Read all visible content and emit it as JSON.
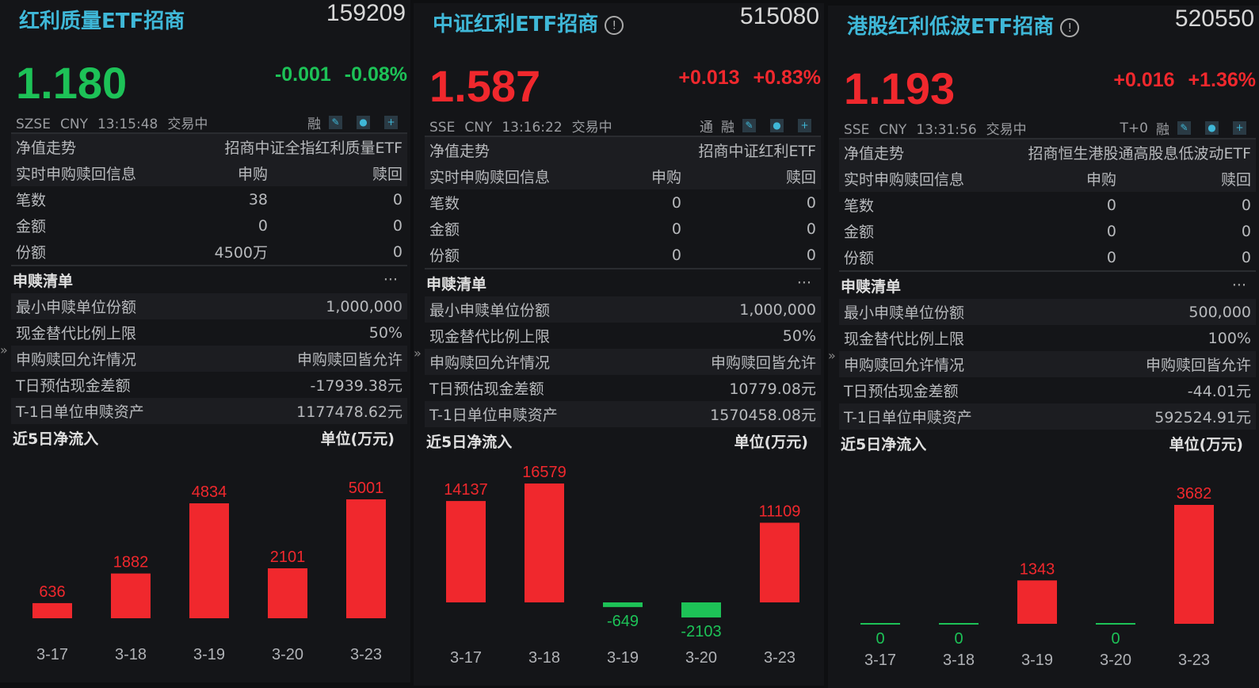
{
  "colors": {
    "up": "#f0282d",
    "down": "#1dc257",
    "title": "#3fb8d8"
  },
  "panels": [
    {
      "title": "红利质量ETF招商",
      "has_info": false,
      "code": "159209",
      "price": "1.180",
      "change": "-0.001",
      "change_pct": "-0.08%",
      "direction": "down",
      "exchange": "SZSE",
      "currency": "CNY",
      "time": "13:15:48",
      "status": "交易中",
      "tags": [
        "融"
      ],
      "nav_label": "净值走势",
      "fund_name": "招商中证全指红利质量ETF",
      "realtime": {
        "label": "实时申购赎回信息",
        "col1": "申购",
        "col2": "赎回",
        "rows": [
          {
            "k": "笔数",
            "a": "38",
            "b": "0"
          },
          {
            "k": "金额",
            "a": "0",
            "b": "0"
          },
          {
            "k": "份额",
            "a": "4500万",
            "b": "0"
          }
        ]
      },
      "list": {
        "label": "申赎清单",
        "more": "···",
        "rows": [
          {
            "k": "最小申赎单位份额",
            "v": "1,000,000"
          },
          {
            "k": "现金替代比例上限",
            "v": "50%"
          },
          {
            "k": "申购赎回允许情况",
            "v": "申购赎回皆允许"
          },
          {
            "k": "T日预估现金差额",
            "v": "-17939.38元"
          },
          {
            "k": "T-1日单位申赎资产",
            "v": "1177478.62元"
          }
        ]
      },
      "flow": {
        "label": "近5日净流入",
        "unit": "单位(万元)",
        "dates": [
          "3-17",
          "3-18",
          "3-19",
          "3-20",
          "3-23"
        ],
        "values": [
          636,
          1882,
          4834,
          2101,
          5001
        ]
      }
    },
    {
      "title": "中证红利ETF招商",
      "has_info": true,
      "code": "515080",
      "price": "1.587",
      "change": "+0.013",
      "change_pct": "+0.83%",
      "direction": "up",
      "exchange": "SSE",
      "currency": "CNY",
      "time": "13:16:22",
      "status": "交易中",
      "tags": [
        "通",
        "融"
      ],
      "nav_label": "净值走势",
      "fund_name": "招商中证红利ETF",
      "realtime": {
        "label": "实时申购赎回信息",
        "col1": "申购",
        "col2": "赎回",
        "rows": [
          {
            "k": "笔数",
            "a": "0",
            "b": "0"
          },
          {
            "k": "金额",
            "a": "0",
            "b": "0"
          },
          {
            "k": "份额",
            "a": "0",
            "b": "0"
          }
        ]
      },
      "list": {
        "label": "申赎清单",
        "more": "···",
        "rows": [
          {
            "k": "最小申赎单位份额",
            "v": "1,000,000"
          },
          {
            "k": "现金替代比例上限",
            "v": "50%"
          },
          {
            "k": "申购赎回允许情况",
            "v": "申购赎回皆允许"
          },
          {
            "k": "T日预估现金差额",
            "v": "10779.08元"
          },
          {
            "k": "T-1日单位申赎资产",
            "v": "1570458.08元"
          }
        ]
      },
      "flow": {
        "label": "近5日净流入",
        "unit": "单位(万元)",
        "dates": [
          "3-17",
          "3-18",
          "3-19",
          "3-20",
          "3-23"
        ],
        "values": [
          14137,
          16579,
          -649,
          -2103,
          11109
        ]
      }
    },
    {
      "title": "港股红利低波ETF招商",
      "has_info": true,
      "code": "520550",
      "price": "1.193",
      "change": "+0.016",
      "change_pct": "+1.36%",
      "direction": "up",
      "exchange": "SSE",
      "currency": "CNY",
      "time": "13:31:56",
      "status": "交易中",
      "tags": [
        "T+0",
        "融"
      ],
      "nav_label": "净值走势",
      "fund_name": "招商恒生港股通高股息低波动ETF",
      "realtime": {
        "label": "实时申购赎回信息",
        "col1": "申购",
        "col2": "赎回",
        "rows": [
          {
            "k": "笔数",
            "a": "0",
            "b": "0"
          },
          {
            "k": "金额",
            "a": "0",
            "b": "0"
          },
          {
            "k": "份额",
            "a": "0",
            "b": "0"
          }
        ]
      },
      "list": {
        "label": "申赎清单",
        "more": "···",
        "rows": [
          {
            "k": "最小申赎单位份额",
            "v": "500,000"
          },
          {
            "k": "现金替代比例上限",
            "v": "100%"
          },
          {
            "k": "申购赎回允许情况",
            "v": "申购赎回皆允许"
          },
          {
            "k": "T日预估现金差额",
            "v": "-44.01元"
          },
          {
            "k": "T-1日单位申赎资产",
            "v": "592524.91元"
          }
        ]
      },
      "flow": {
        "label": "近5日净流入",
        "unit": "单位(万元)",
        "dates": [
          "3-17",
          "3-18",
          "3-19",
          "3-20",
          "3-23"
        ],
        "values": [
          0,
          0,
          1343,
          0,
          3682
        ]
      }
    }
  ]
}
